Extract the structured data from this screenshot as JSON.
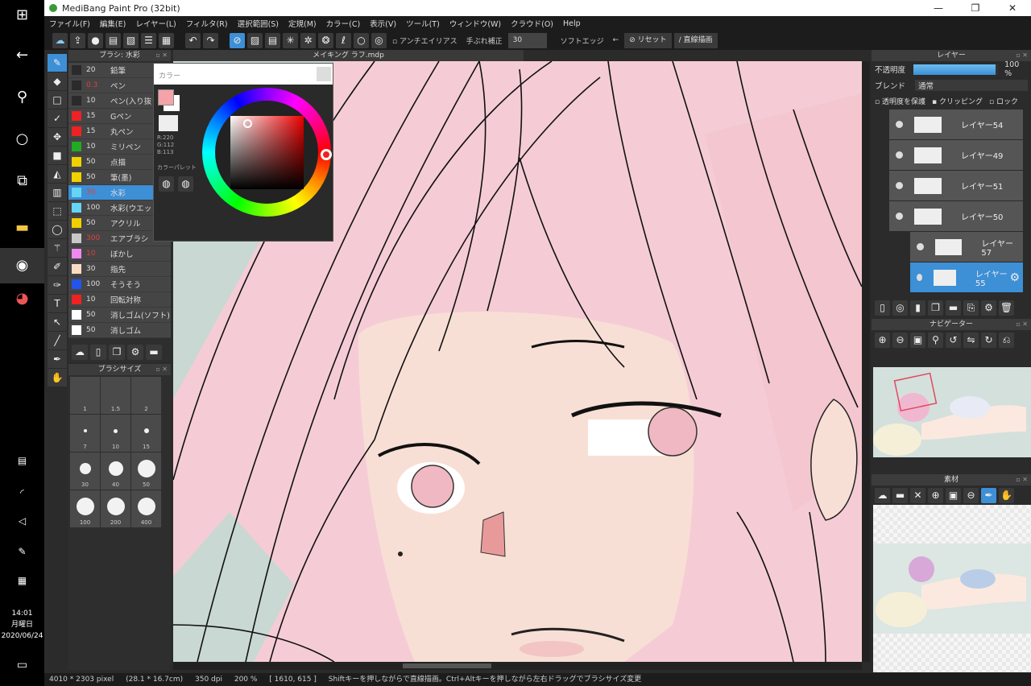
{
  "window": {
    "title": "MediBang Paint Pro (32bit)",
    "minimize": "—",
    "maximize": "❐",
    "close": "✕"
  },
  "taskbar": {
    "time": "14:01",
    "weekday": "月曜日",
    "date": "2020/06/24"
  },
  "menu": [
    "ファイル(F)",
    "編集(E)",
    "レイヤー(L)",
    "フィルタ(R)",
    "選択範囲(S)",
    "定規(M)",
    "カラー(C)",
    "表示(V)",
    "ツール(T)",
    "ウィンドウ(W)",
    "クラウド(O)",
    "Help"
  ],
  "toolbar": {
    "antialias_label": "アンチエイリアス",
    "correction_label": "手ぶれ補正",
    "correction_value": "30",
    "soft_edge_label": "ソフトエッジ",
    "reset_label": "リセット",
    "parallel_label": "直線描画"
  },
  "brush_panel": {
    "title": "ブラシ: 水彩",
    "items": [
      {
        "size": "20",
        "name": "鉛筆",
        "color": "#2a2a2a",
        "red": false
      },
      {
        "size": "0.3",
        "name": "ペン",
        "color": "#2a2a2a",
        "red": true
      },
      {
        "size": "10",
        "name": "ペン(入り抜き)",
        "color": "#2a2a2a",
        "red": false
      },
      {
        "size": "15",
        "name": "Gペン",
        "color": "#ee2222",
        "red": false
      },
      {
        "size": "15",
        "name": "丸ペン",
        "color": "#ee2222",
        "red": false
      },
      {
        "size": "10",
        "name": "ミリペン",
        "color": "#22aa22",
        "red": false
      },
      {
        "size": "50",
        "name": "点描",
        "color": "#f0d000",
        "red": false
      },
      {
        "size": "50",
        "name": "筆(墨)",
        "color": "#f0d000",
        "red": false
      },
      {
        "size": "30",
        "name": "水彩",
        "color": "#66d4f4",
        "red": true,
        "selected": true
      },
      {
        "size": "100",
        "name": "水彩(ウエット)",
        "color": "#66d4f4",
        "red": false
      },
      {
        "size": "50",
        "name": "アクリル",
        "color": "#f0d000",
        "red": false
      },
      {
        "size": "300",
        "name": "エアブラシ",
        "color": "#c8c8c8",
        "red": true
      },
      {
        "size": "10",
        "name": "ぼかし",
        "color": "#f088f0",
        "red": true
      },
      {
        "size": "30",
        "name": "指先",
        "color": "#fadcc4",
        "red": false
      },
      {
        "size": "100",
        "name": "そうそう",
        "color": "#2255ee",
        "red": false
      },
      {
        "size": "10",
        "name": "回転対称",
        "color": "#ee2222",
        "red": false
      },
      {
        "size": "50",
        "name": "消しゴム(ソフト)",
        "color": "#ffffff",
        "red": false
      },
      {
        "size": "50",
        "name": "消しゴム",
        "color": "#ffffff",
        "red": false
      }
    ]
  },
  "brush_size": {
    "title": "ブラシサイズ",
    "sizes": [
      {
        "label": "1",
        "dot": 0
      },
      {
        "label": "1.5",
        "dot": 0
      },
      {
        "label": "2",
        "dot": 0
      },
      {
        "label": "7",
        "dot": 4
      },
      {
        "label": "10",
        "dot": 5
      },
      {
        "label": "15",
        "dot": 6
      },
      {
        "label": "30",
        "dot": 14
      },
      {
        "label": "40",
        "dot": 18
      },
      {
        "label": "50",
        "dot": 22
      },
      {
        "label": "100",
        "dot": 22
      },
      {
        "label": "200",
        "dot": 22
      },
      {
        "label": "400",
        "dot": 22
      }
    ]
  },
  "canvas": {
    "title": "メイキング ラフ.mdp"
  },
  "color_panel": {
    "title": "カラー",
    "r": "R:220",
    "g": "G:112",
    "b": "B:113",
    "palette_label": "カラーパレット",
    "fg_color": "#f4a3a8"
  },
  "layer_panel": {
    "title": "レイヤー",
    "opacity_label": "不透明度",
    "opacity_value": "100 %",
    "opacity": 100,
    "blend_label": "ブレンド",
    "blend_value": "通常",
    "protect_label": "透明度を保護",
    "clipping_label": "クリッピング",
    "lock_label": "ロック",
    "layers": [
      {
        "name": "レイヤー54"
      },
      {
        "name": "レイヤー49"
      },
      {
        "name": "レイヤー51"
      },
      {
        "name": "レイヤー50"
      },
      {
        "name": "レイヤー57",
        "indent": true
      },
      {
        "name": "レイヤー55",
        "indent": true,
        "selected": true
      }
    ]
  },
  "navigator": {
    "title": "ナビゲーター"
  },
  "material": {
    "title": "素材"
  },
  "status": {
    "size": "4010 * 2303 pixel",
    "physical": "(28.1 * 16.7cm)",
    "dpi": "350 dpi",
    "zoom": "200 %",
    "coords": "[ 1610, 615 ]",
    "hint": "Shiftキーを押しながらで直線描画。Ctrl+Altキーを押しながら左右ドラッグでブラシサイズ変更"
  }
}
